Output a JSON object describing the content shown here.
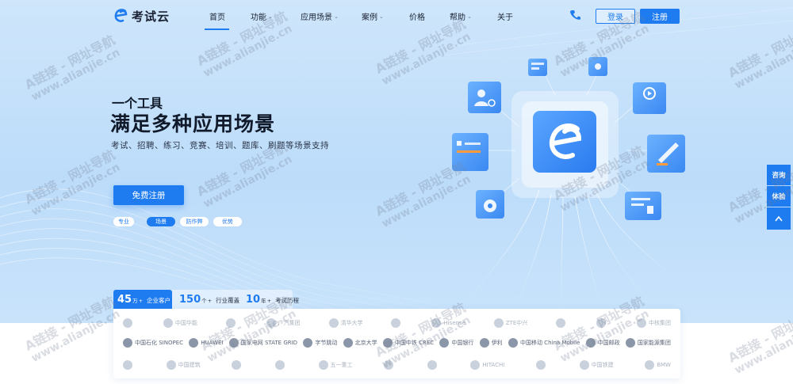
{
  "brand": {
    "name": "考试云",
    "primary": "#1f7cf0"
  },
  "nav": {
    "items": [
      {
        "label": "首页",
        "dropdown": false,
        "active": true
      },
      {
        "label": "功能",
        "dropdown": true,
        "active": false
      },
      {
        "label": "应用场景",
        "dropdown": true,
        "active": false
      },
      {
        "label": "案例",
        "dropdown": true,
        "active": false
      },
      {
        "label": "价格",
        "dropdown": false,
        "active": false
      },
      {
        "label": "帮助",
        "dropdown": true,
        "active": false
      },
      {
        "label": "关于",
        "dropdown": false,
        "active": false
      }
    ],
    "login": "登录",
    "register": "注册"
  },
  "hero": {
    "kicker": "一个工具",
    "title": "满足多种应用场景",
    "subtitle": "考试、招聘、练习、竞赛、培训、题库、刷题等场景支持",
    "cta": "免费注册",
    "tags": [
      {
        "label": "专业",
        "active": false
      },
      {
        "label": "场景",
        "active": true
      },
      {
        "label": "防作弊",
        "active": false
      },
      {
        "label": "优势",
        "active": false
      }
    ]
  },
  "side": {
    "consult": "咨询",
    "trial": "体验"
  },
  "stats": [
    {
      "num": "45",
      "unit": "万",
      "plus": "+",
      "label": "企业客户"
    },
    {
      "num": "150",
      "unit": "个",
      "plus": "+",
      "label": "行业覆盖"
    },
    {
      "num": "10",
      "unit": "年",
      "plus": "+",
      "label": "考试历程"
    }
  ],
  "clients": {
    "row1": [
      "",
      "中国华能",
      "",
      "广汽集团",
      "清华大学",
      "",
      "Hisense",
      "ZTE中兴",
      "",
      "",
      "中核集团"
    ],
    "row2": [
      "中国石化 SINOPEC",
      "HUAWEI",
      "国家电网 STATE GRID",
      "字节跳动",
      "北京大学",
      "中国中铁 CREC",
      "中国银行",
      "伊利",
      "中国移动 China Mobile",
      "中国邮政",
      "国家能源集团"
    ],
    "row3": [
      "",
      "中国建筑",
      "",
      "",
      "五一重工",
      "",
      "",
      "HITACHI",
      "",
      "中国铁建",
      "BMW"
    ]
  },
  "watermark": {
    "line1": "A链接 - 网址导航",
    "line2": "www.alianjie.cn"
  }
}
